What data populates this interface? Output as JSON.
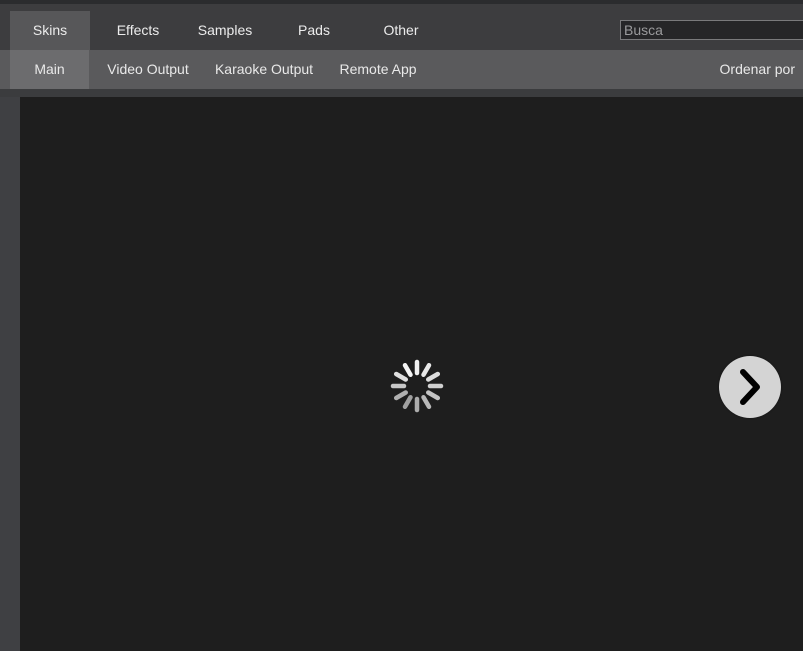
{
  "tabs": [
    {
      "label": "Skins",
      "active": true
    },
    {
      "label": "Effects",
      "active": false
    },
    {
      "label": "Samples",
      "active": false
    },
    {
      "label": "Pads",
      "active": false
    },
    {
      "label": "Other",
      "active": false
    }
  ],
  "search": {
    "placeholder": "Busca",
    "value": ""
  },
  "subtabs": [
    {
      "label": "Main",
      "active": true
    },
    {
      "label": "Video Output",
      "active": false
    },
    {
      "label": "Karaoke Output",
      "active": false
    },
    {
      "label": "Remote App",
      "active": false
    }
  ],
  "sort": {
    "label": "Ordenar por"
  },
  "preview": {
    "loading": true,
    "spinner_icon": "loading-spinner-icon",
    "next_icon": "chevron-right-icon"
  },
  "colors": {
    "background": "#1e1e1e",
    "tabbar": "#3d3d3f",
    "active_tab": "#575759",
    "subbar": "#5a5a5c"
  }
}
